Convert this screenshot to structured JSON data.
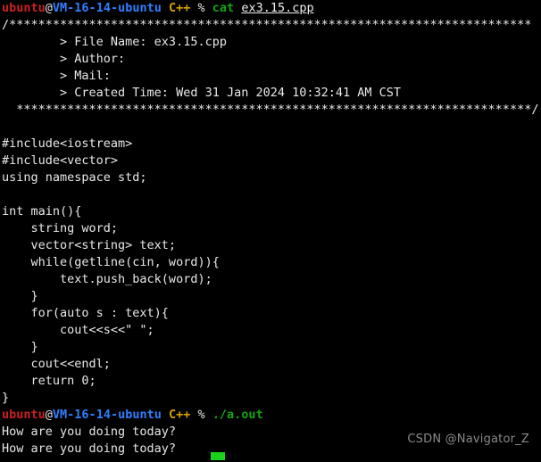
{
  "terminal": {
    "background": "#000000",
    "colors": {
      "user": "#cc1f1f",
      "host": "#2e7fff",
      "dir": "#d6a000",
      "command": "#12a312",
      "text": "#e6e6e6",
      "cursor": "#1bd21b",
      "watermark": "#8a8a8a"
    },
    "prompt1": {
      "user": "ubuntu",
      "at": "@",
      "host": "VM-16-14-ubuntu",
      "dir": "C++",
      "sigil": "%",
      "command": "cat",
      "argument": "ex3.15.cpp"
    },
    "prompt2": {
      "user": "ubuntu",
      "at": "@",
      "host": "VM-16-14-ubuntu",
      "dir": "C++",
      "sigil": "%",
      "command": "./a.out"
    },
    "file_header": {
      "top_border": "/************************************************************************",
      "file_name_line": "        > File Name: ex3.15.cpp",
      "author_line": "        > Author:",
      "mail_line": "        > Mail:",
      "created_time_line": "        > Created Time: Wed 31 Jan 2024 10:32:41 AM CST",
      "bottom_border": "  ***********************************************************************/"
    },
    "code_lines": [
      "#include<iostream>",
      "#include<vector>",
      "using namespace std;",
      "",
      "int main(){",
      "    string word;",
      "    vector<string> text;",
      "    while(getline(cin, word)){",
      "        text.push_back(word);",
      "    }",
      "    for(auto s : text){",
      "        cout<<s<<\" \";",
      "    }",
      "    cout<<endl;",
      "    return 0;",
      "}"
    ],
    "program_io": [
      "How are you doing today?",
      "How are you doing today?"
    ],
    "watermark": "CSDN @Navigator_Z"
  }
}
